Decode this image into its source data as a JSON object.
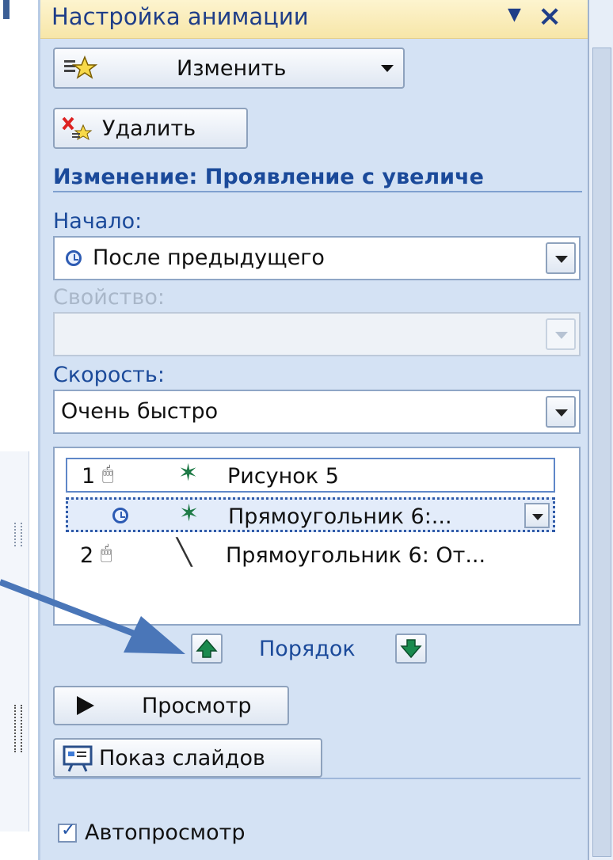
{
  "panel": {
    "title": "Настройка анимации",
    "change_button": "Изменить",
    "delete_button": "Удалить",
    "section_title": "Изменение: Проявление с увеличе",
    "start": {
      "label": "Начало:",
      "value": "После предыдущего"
    },
    "property": {
      "label": "Свойство:",
      "value": ""
    },
    "speed": {
      "label": "Скорость:",
      "value": "Очень быстро"
    },
    "list": [
      {
        "number": "1",
        "name": "Рисунок 5"
      },
      {
        "number": "",
        "name": "Прямоугольник 6:..."
      },
      {
        "number": "2",
        "name": "Прямоугольник 6: От..."
      }
    ],
    "order_label": "Порядок",
    "preview_button": "Просмотр",
    "slideshow_button": "Показ слайдов",
    "autopreview_label": "Автопросмотр",
    "autopreview_checked": true
  },
  "icons": {
    "title_dropdown": "dropdown-arrow-icon",
    "title_close": "close-icon",
    "change": "star-effects-icon",
    "delete": "delete-effect-icon",
    "start_clock": "clock-icon",
    "on_click": "mouse-icon",
    "entrance_effect": "entrance-star-icon",
    "motion_path": "motion-path-icon",
    "move_up": "move-up-icon",
    "move_down": "move-down-icon",
    "play": "play-icon",
    "slideshow": "slideshow-icon"
  },
  "colors": {
    "panel_bg": "#d4e2f4",
    "title_bg": "#f7e6a8",
    "accent_text": "#1b4a9a",
    "annotation_arrow": "#4a76b8"
  }
}
